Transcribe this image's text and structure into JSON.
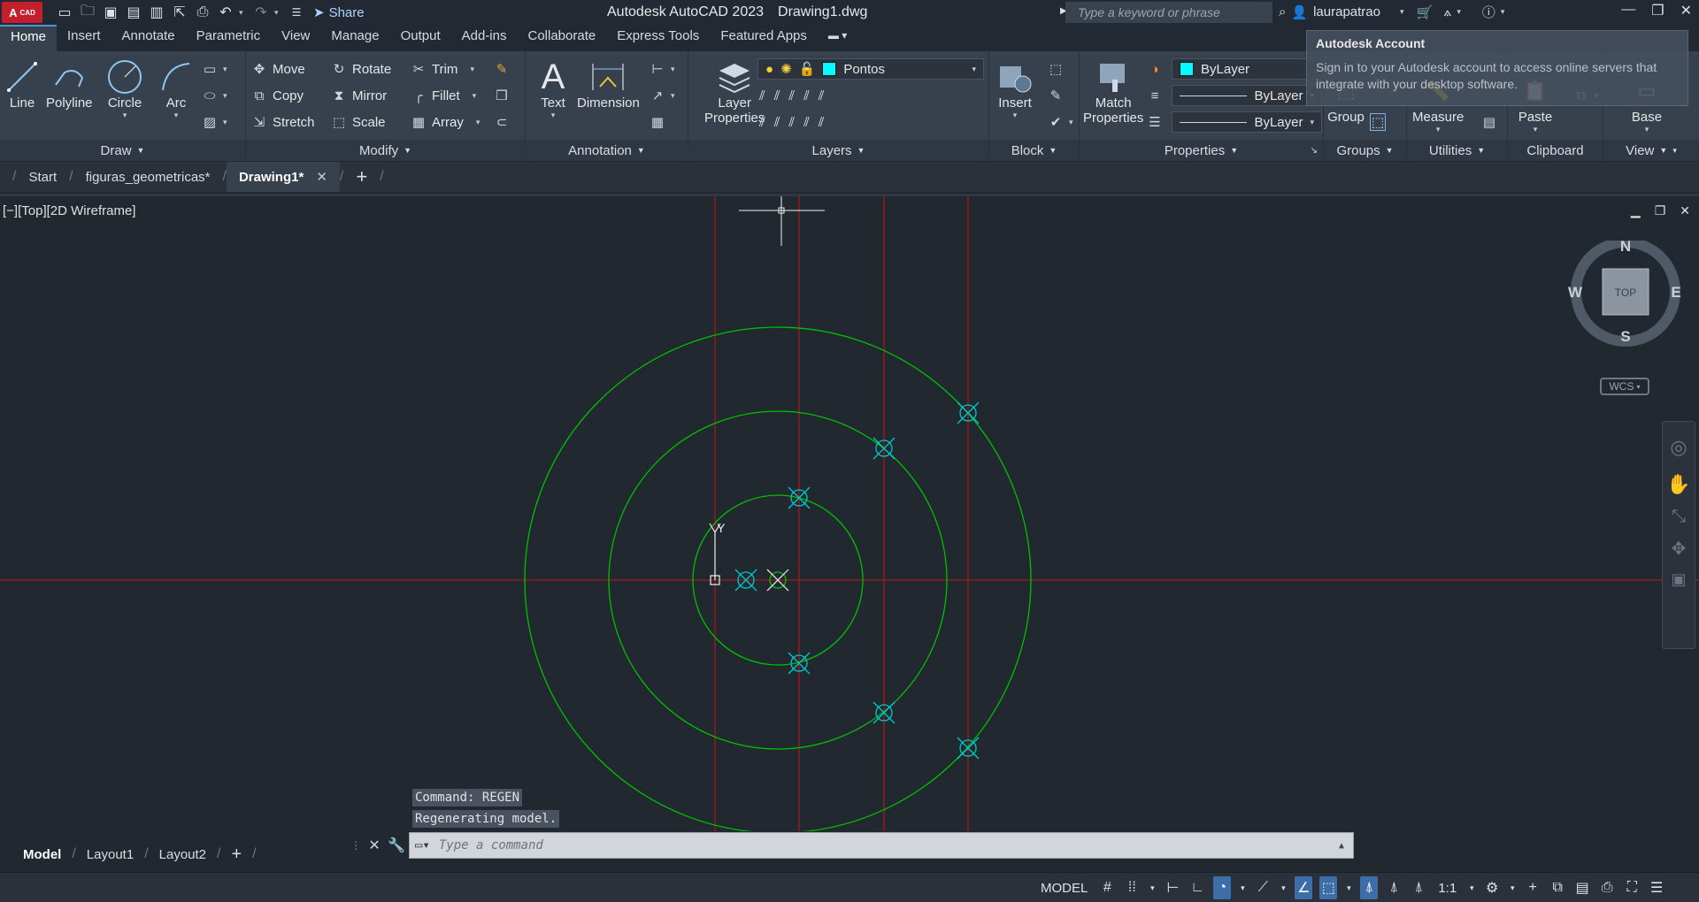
{
  "titlebar": {
    "logo": "A",
    "logo_small": "CAD",
    "share_label": "Share",
    "app_title": "Autodesk AutoCAD 2023",
    "file_title": "Drawing1.dwg",
    "search_placeholder": "Type a keyword or phrase",
    "user": "laurapatrao"
  },
  "ribbon_tabs": [
    "Home",
    "Insert",
    "Annotate",
    "Parametric",
    "View",
    "Manage",
    "Output",
    "Add-ins",
    "Collaborate",
    "Express Tools",
    "Featured Apps"
  ],
  "ribbon": {
    "draw": {
      "title": "Draw",
      "line": "Line",
      "polyline": "Polyline",
      "circle": "Circle",
      "arc": "Arc"
    },
    "modify": {
      "title": "Modify",
      "move": "Move",
      "rotate": "Rotate",
      "trim": "Trim",
      "copy": "Copy",
      "mirror": "Mirror",
      "fillet": "Fillet",
      "stretch": "Stretch",
      "scale": "Scale",
      "array": "Array"
    },
    "annotation": {
      "title": "Annotation",
      "text": "Text",
      "dimension": "Dimension"
    },
    "layers": {
      "title": "Layers",
      "layer_properties_1": "Layer",
      "layer_properties_2": "Properties",
      "current_layer": "Pontos"
    },
    "block": {
      "title": "Block",
      "insert": "Insert"
    },
    "properties": {
      "title": "Properties",
      "match_1": "Match",
      "match_2": "Properties",
      "color": "ByLayer",
      "lineweight": "ByLayer",
      "linetype": "ByLayer"
    },
    "groups": {
      "title": "Groups",
      "group": "Group"
    },
    "utilities": {
      "title": "Utilities",
      "measure": "Measure"
    },
    "clipboard": {
      "title": "Clipboard",
      "paste": "Paste"
    },
    "view": {
      "title": "View",
      "base": "Base"
    }
  },
  "account_flyout": {
    "heading": "Autodesk Account",
    "body": "Sign in to your Autodesk account to access online servers that integrate with your desktop software."
  },
  "doc_tabs": {
    "start": "Start",
    "file1": "figuras_geometricas*",
    "file2": "Drawing1*",
    "close": "✕",
    "add": "+"
  },
  "viewport": {
    "label": "[−][Top][2D Wireframe]",
    "compass": {
      "n": "N",
      "s": "S",
      "e": "E",
      "w": "W",
      "top": "TOP"
    },
    "wcs": "WCS",
    "ucs_y": "Y"
  },
  "command": {
    "history": [
      "Command: REGEN",
      "Regenerating model."
    ],
    "placeholder": "Type a command"
  },
  "layout_tabs": [
    "Model",
    "Layout1",
    "Layout2"
  ],
  "status": {
    "model": "MODEL",
    "scale": "1:1"
  },
  "colors": {
    "accent": "#4c95d8",
    "circle": "#00c000",
    "axis": "#c81414",
    "point": "#00c8c8"
  }
}
